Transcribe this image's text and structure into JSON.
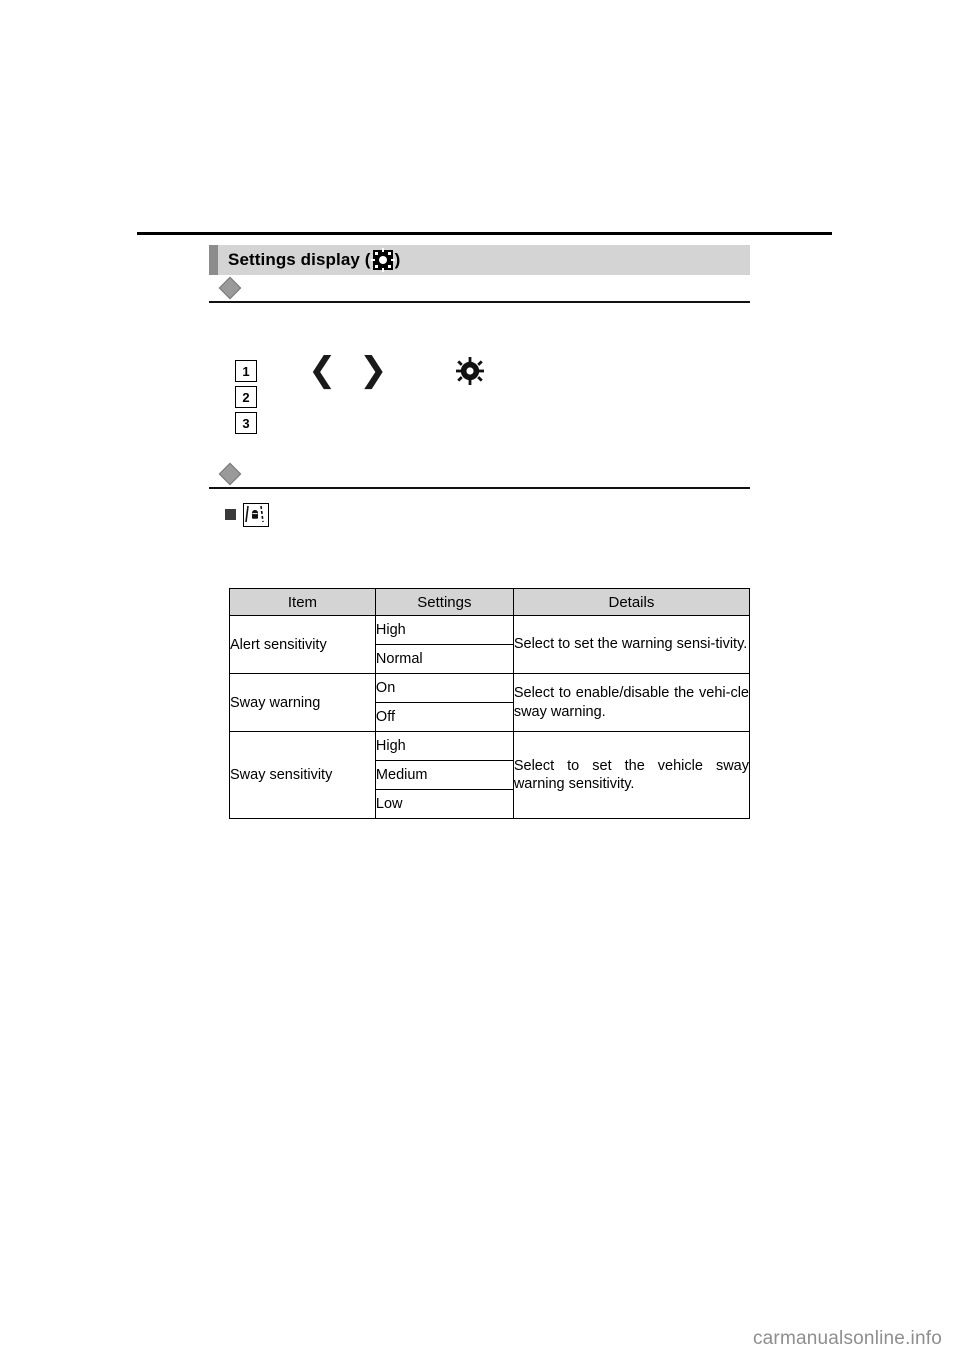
{
  "page": {
    "top_rule": true,
    "footer_text": "carmanualsonline.info"
  },
  "section": {
    "title_prefix": "Settings display (",
    "title_suffix": ")",
    "gear_icon": "gear-icon"
  },
  "diagram": {
    "numbers": [
      "1",
      "2",
      "3"
    ],
    "left_arrow_icon": "chevron-left-icon",
    "right_arrow_icon": "chevron-right-icon",
    "gear_icon": "gear-icon"
  },
  "subsection": {
    "bullet_icon": "square-bullet",
    "lane_icon": "lane-departure-alert-icon"
  },
  "table": {
    "headers": [
      "Item",
      "Settings",
      "Details"
    ],
    "rows": [
      {
        "item": "Alert sensitivity",
        "settings": [
          "High",
          "Normal"
        ],
        "details": "Select to set the warning sensi-tivity."
      },
      {
        "item": "Sway warning",
        "settings": [
          "On",
          "Off"
        ],
        "details": "Select to enable/disable the vehi-cle sway warning."
      },
      {
        "item": "Sway sensitivity",
        "settings": [
          "High",
          "Medium",
          "Low"
        ],
        "details": "Select to set the vehicle sway warning sensitivity."
      }
    ]
  }
}
